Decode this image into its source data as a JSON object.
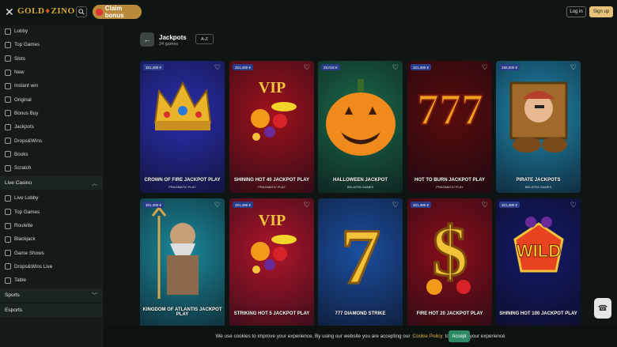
{
  "header": {
    "logo_left": "GOLD",
    "logo_right": "ZINO",
    "claim_bonus": "Claim bonus",
    "login": "Log in",
    "signup": "Sign up"
  },
  "sidebar": {
    "items": [
      {
        "label": "Lobby",
        "icon": "lobby-icon"
      },
      {
        "label": "Top Games",
        "icon": "star-icon"
      },
      {
        "label": "Slots",
        "icon": "slots-icon"
      },
      {
        "label": "New",
        "icon": "new-icon"
      },
      {
        "label": "Instant win",
        "icon": "instant-icon"
      },
      {
        "label": "Original",
        "icon": "original-icon"
      },
      {
        "label": "Bonus Buy",
        "icon": "bonus-icon"
      },
      {
        "label": "Jackpots",
        "icon": "jackpot-icon"
      },
      {
        "label": "Drops&Wins",
        "icon": "drops-icon"
      },
      {
        "label": "Books",
        "icon": "book-icon"
      },
      {
        "label": "Scratch",
        "icon": "scratch-icon"
      }
    ],
    "live_casino": "Live Casino",
    "live_items": [
      {
        "label": "Live Lobby",
        "icon": "live-lobby-icon"
      },
      {
        "label": "Top Games",
        "icon": "star-icon"
      },
      {
        "label": "Roulette",
        "icon": "roulette-icon"
      },
      {
        "label": "Blackjack",
        "icon": "cards-icon"
      },
      {
        "label": "Game Shows",
        "icon": "gameshow-icon"
      },
      {
        "label": "Drops&Wins Live",
        "icon": "drops-icon"
      },
      {
        "label": "Table",
        "icon": "table-icon"
      }
    ],
    "sports": "Sports",
    "esports": "Esports"
  },
  "page": {
    "title": "Jackpots",
    "subtitle": "24 games",
    "sort": "A-Z"
  },
  "games": [
    {
      "name": "CROWN OF FIRE JACKPOT PLAY",
      "provider": "PRAGMATIC PLAY",
      "jackpot": "321,490 €",
      "bg": "#2a2fb0",
      "accent": "#e8b52a",
      "art": "crown"
    },
    {
      "name": "SHINING HOT 40 JACKPOT PLAY",
      "provider": "PRAGMATIC PLAY",
      "jackpot": "321,490 €",
      "bg": "#a0121d",
      "accent": "#f2c23a",
      "art": "vip"
    },
    {
      "name": "HALLOWEEN JACKPOT",
      "provider": "BELATRA GAMES",
      "jackpot": "25,018 €",
      "bg": "#1b6c4a",
      "accent": "#f08a1d",
      "art": "pumpkin"
    },
    {
      "name": "HOT TO BURN JACKPOT PLAY",
      "provider": "PRAGMATIC PLAY",
      "jackpot": "321,490 €",
      "bg": "#5a0b0b",
      "accent": "#f0a020",
      "art": "777"
    },
    {
      "name": "PIRATE JACKPOTS",
      "provider": "BELATRA GAMES",
      "jackpot": "150,000 €",
      "bg": "#1e8ab0",
      "accent": "#b5402a",
      "art": "pirate"
    },
    {
      "name": "KINGDOM OF ATLANTIS JACKPOT PLAY",
      "provider": "",
      "jackpot": "321,490 €",
      "bg": "#1b8a9a",
      "accent": "#d8a64a",
      "art": "atlantis"
    },
    {
      "name": "STRIKING HOT 5 JACKPOT PLAY",
      "provider": "",
      "jackpot": "321,490 €",
      "bg": "#b0152a",
      "accent": "#f2c23a",
      "art": "vip"
    },
    {
      "name": "777 DIAMOND STRIKE",
      "provider": "",
      "jackpot": "",
      "bg": "#1b4fa0",
      "accent": "#f2c23a",
      "art": "seven"
    },
    {
      "name": "FIRE HOT 20 JACKPOT PLAY",
      "provider": "",
      "jackpot": "321,490 €",
      "bg": "#8a0e1a",
      "accent": "#f2c23a",
      "art": "dollar"
    },
    {
      "name": "SHINING HOT 100 JACKPOT PLAY",
      "provider": "",
      "jackpot": "321,490 €",
      "bg": "#141a6a",
      "accent": "#e8431f",
      "art": "wild"
    }
  ],
  "cookie": {
    "text_before": "We use cookies to improve your experience. By using our website you are accepting our",
    "link": "Cookie Policy",
    "text_after": "to improve your experience",
    "accept": "Accept"
  }
}
